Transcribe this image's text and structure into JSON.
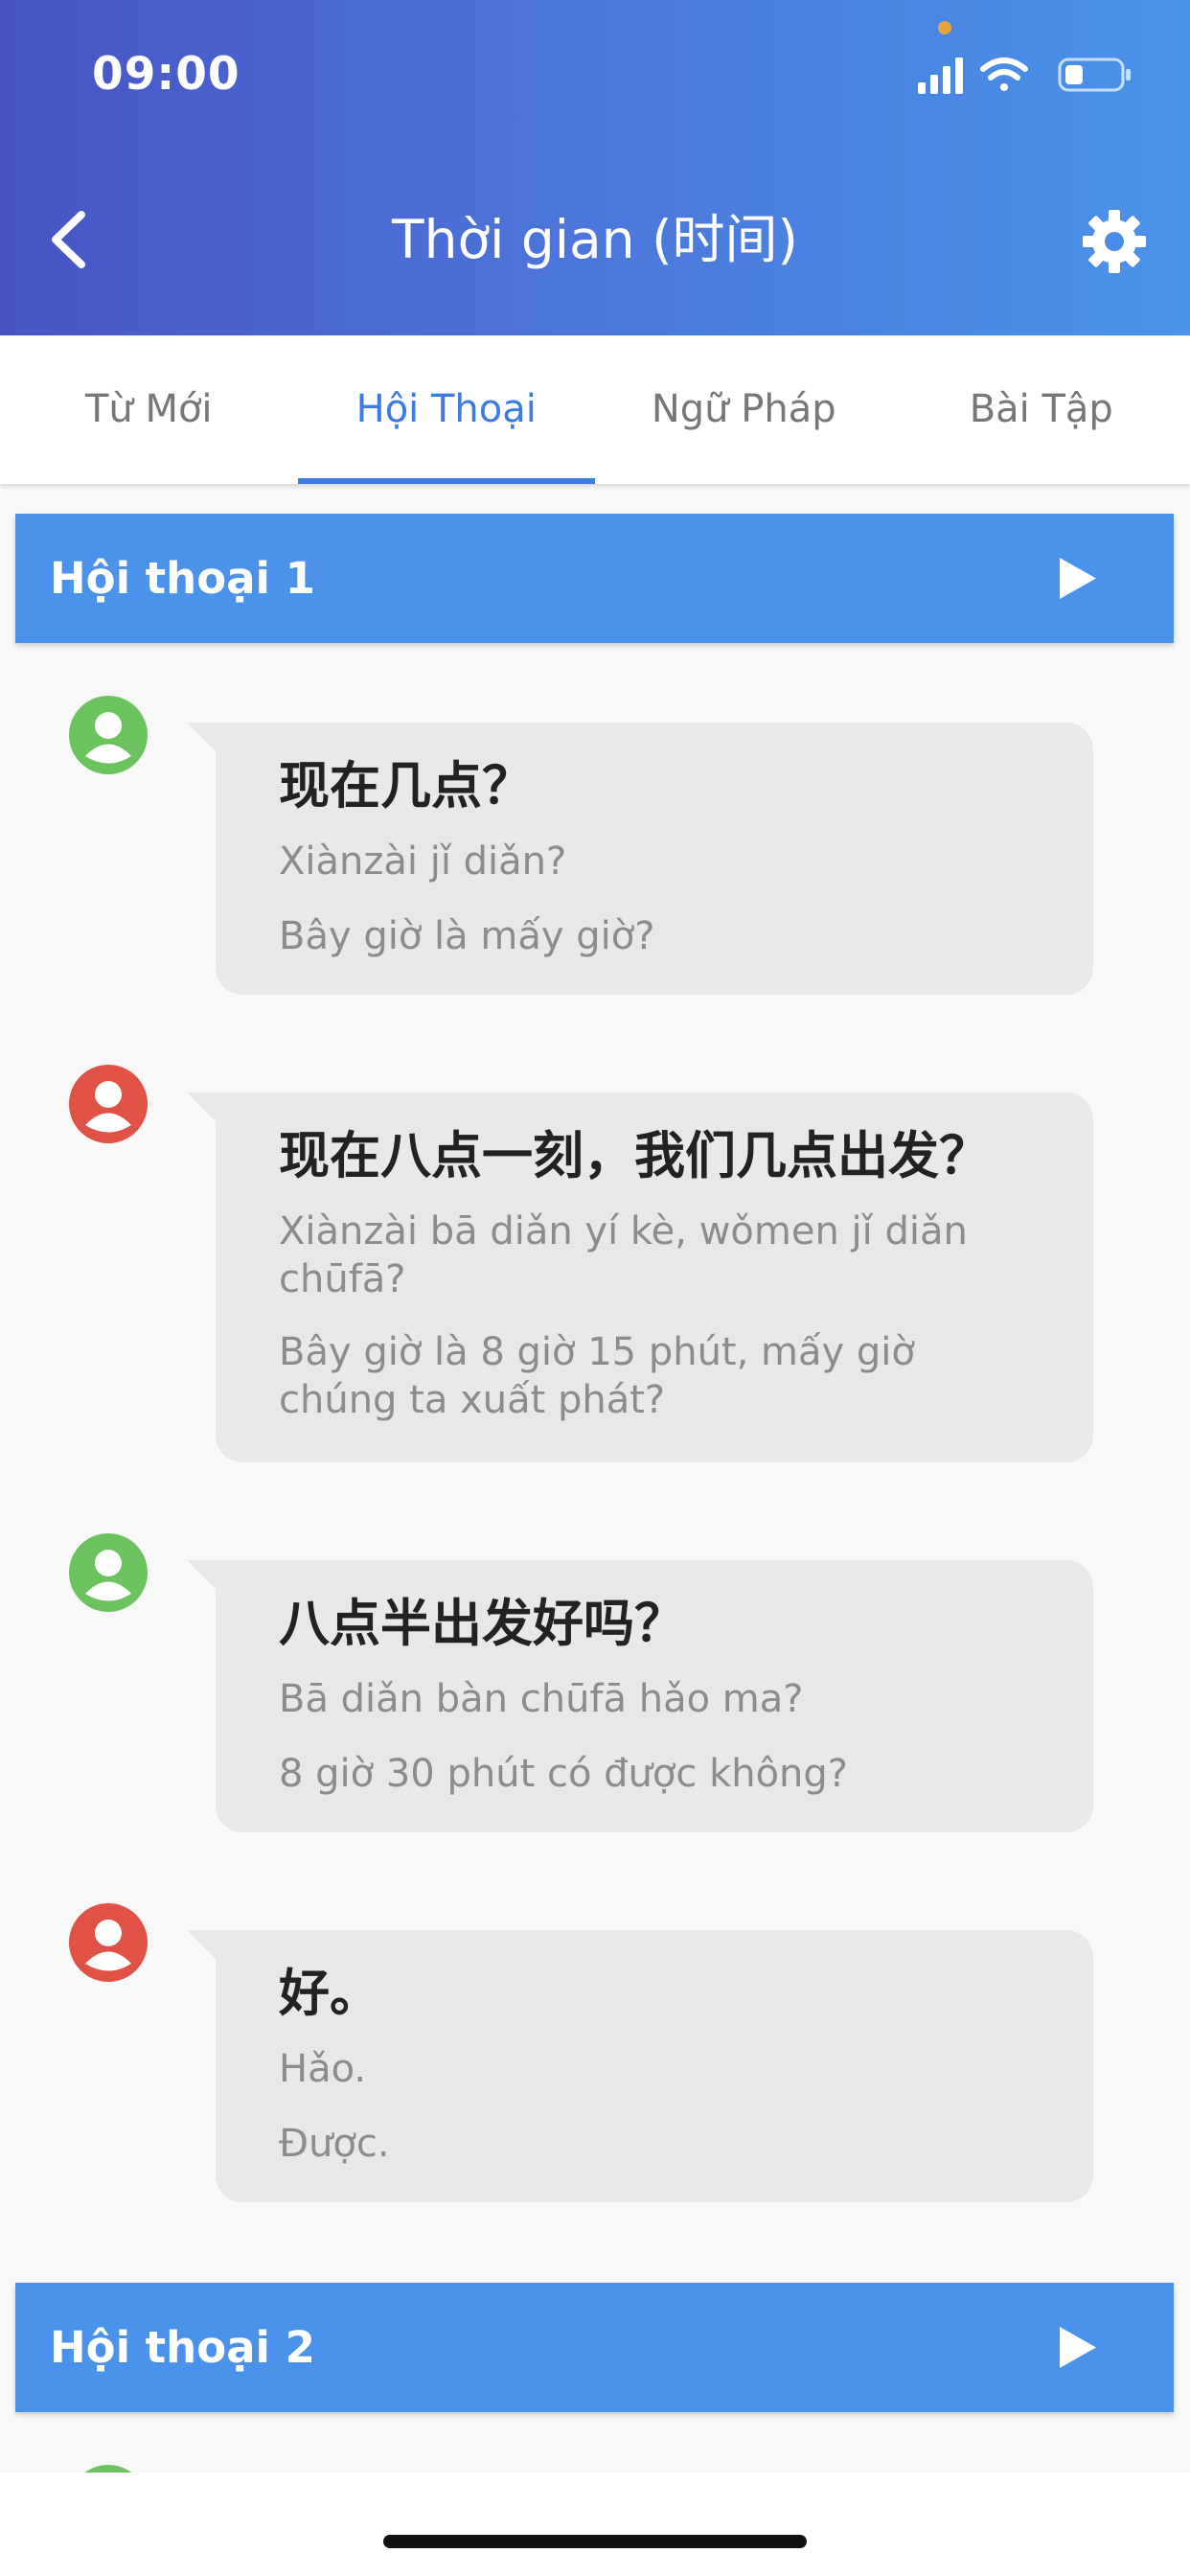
{
  "status_bar": {
    "time": "09:00"
  },
  "header": {
    "title": "Thời gian (时间)"
  },
  "tabs": [
    {
      "label": "Từ Mới",
      "active": false
    },
    {
      "label": "Hội Thoại",
      "active": true
    },
    {
      "label": "Ngữ Pháp",
      "active": false
    },
    {
      "label": "Bài Tập",
      "active": false
    }
  ],
  "sections": [
    {
      "title": "Hội thoại 1"
    },
    {
      "title": "Hội thoại 2"
    }
  ],
  "dialogue": [
    {
      "speaker": "green",
      "hanzi": "现在几点？",
      "pinyin": "Xiànzài jǐ diǎn?",
      "meaning": "Bây giờ là mấy giờ?"
    },
    {
      "speaker": "red",
      "hanzi": "现在八点一刻，我们几点出发？",
      "pinyin": "Xiànzài bā diǎn yí kè, wǒmen jǐ diǎn chūfā?",
      "meaning": "Bây giờ là 8 giờ 15 phút, mấy giờ chúng ta xuất phát?"
    },
    {
      "speaker": "green",
      "hanzi": "八点半出发好吗？",
      "pinyin": "Bā diǎn bàn chūfā hǎo ma?",
      "meaning": "8 giờ 30 phút có được không?"
    },
    {
      "speaker": "red",
      "hanzi": "好。",
      "pinyin": "Hǎo.",
      "meaning": "Được."
    }
  ],
  "colors": {
    "speaker_green": "#6cc25f",
    "speaker_red": "#e05246",
    "accent": "#3d7be0",
    "section_bar": "#4a92ea"
  },
  "icons": {
    "back": "chevron-left-icon",
    "settings": "gear-icon",
    "play": "play-icon",
    "avatar": "user-avatar-icon",
    "signal": "signal-icon",
    "wifi": "wifi-icon",
    "battery": "battery-icon"
  }
}
